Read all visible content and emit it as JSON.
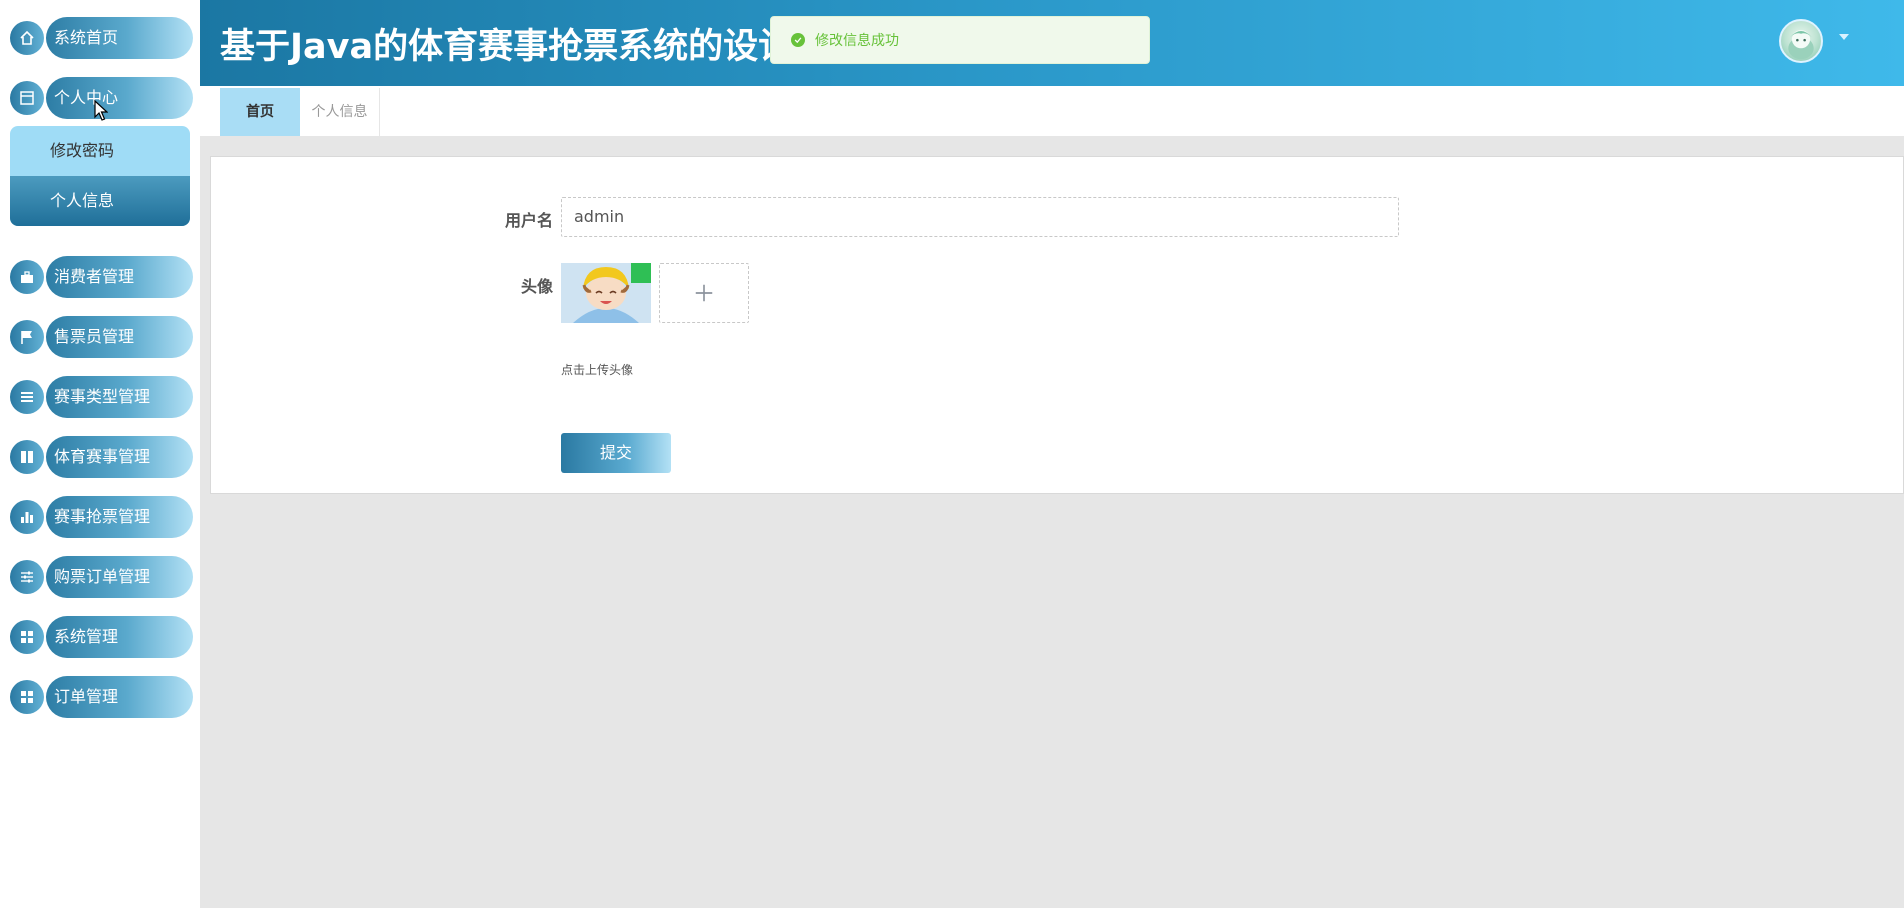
{
  "app": {
    "title": "基于Java的体育赛事抢票系统的设计"
  },
  "toast": {
    "message": "修改信息成功",
    "color": "#67c23a"
  },
  "sidebar": {
    "items": [
      {
        "label": "系统首页",
        "icon": "home-icon"
      },
      {
        "label": "个人中心",
        "icon": "window-icon"
      },
      {
        "label": "消费者管理",
        "icon": "briefcase-icon"
      },
      {
        "label": "售票员管理",
        "icon": "flag-icon"
      },
      {
        "label": "赛事类型管理",
        "icon": "list-icon"
      },
      {
        "label": "体育赛事管理",
        "icon": "book-icon"
      },
      {
        "label": "赛事抢票管理",
        "icon": "bar-chart-icon"
      },
      {
        "label": "购票订单管理",
        "icon": "sliders-icon"
      },
      {
        "label": "系统管理",
        "icon": "grid-icon"
      },
      {
        "label": "订单管理",
        "icon": "grid-icon"
      }
    ],
    "submenu": [
      {
        "label": "修改密码"
      },
      {
        "label": "个人信息"
      }
    ]
  },
  "tabs": [
    {
      "label": "首页"
    },
    {
      "label": "个人信息"
    }
  ],
  "form": {
    "username_label": "用户名",
    "username_value": "admin",
    "avatar_label": "头像",
    "upload_hint": "点击上传头像",
    "submit_label": "提交"
  },
  "colors": {
    "header_start": "#1b77a3",
    "header_end": "#3fb9ea",
    "active_tab": "#a9ddf5"
  }
}
